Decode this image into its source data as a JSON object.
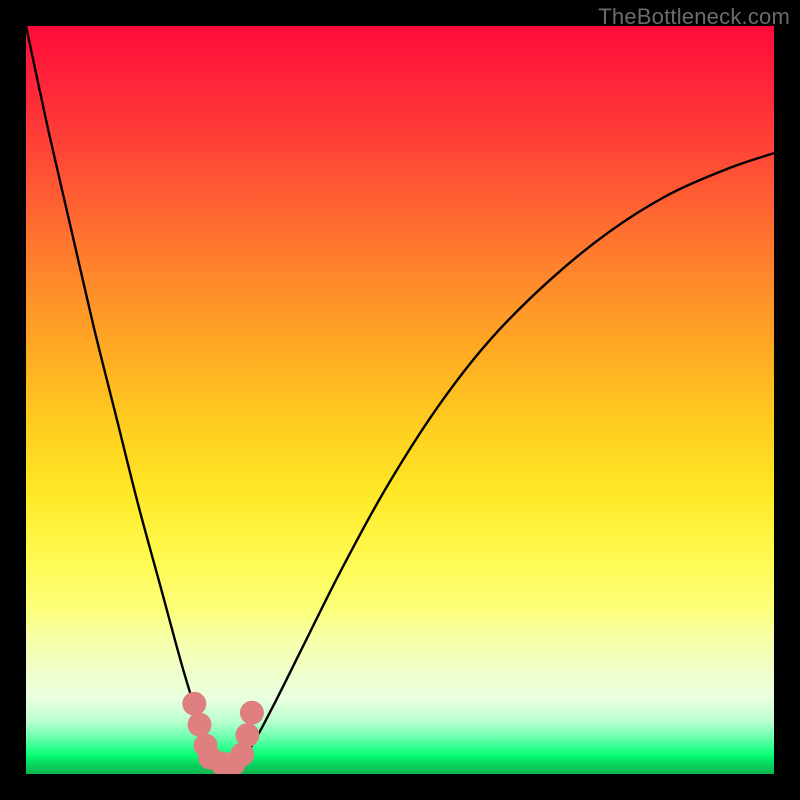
{
  "watermark": {
    "text": "TheBottleneck.com"
  },
  "chart_data": {
    "type": "line",
    "title": "",
    "xlabel": "",
    "ylabel": "",
    "xlim": [
      0,
      100
    ],
    "ylim": [
      0,
      100
    ],
    "grid": false,
    "legend": false,
    "series": [
      {
        "name": "bottleneck-curve",
        "x": [
          0,
          3,
          6,
          9,
          12,
          15,
          18,
          21,
          23.5,
          25,
          26.5,
          28,
          30,
          33,
          37,
          42,
          48,
          55,
          62,
          70,
          78,
          86,
          94,
          100
        ],
        "values": [
          100,
          86,
          73,
          60,
          48,
          36,
          25,
          14,
          6,
          2,
          1,
          1.5,
          3.5,
          9,
          17,
          27,
          38,
          49,
          58,
          66,
          72.5,
          77.5,
          81,
          83
        ]
      }
    ],
    "markers": [
      {
        "name": "dot",
        "x": 22.5,
        "y": 9.4,
        "r": 1.6,
        "color": "#df7f7f"
      },
      {
        "name": "dot",
        "x": 23.2,
        "y": 6.6,
        "r": 1.6,
        "color": "#df7f7f"
      },
      {
        "name": "dot",
        "x": 24.0,
        "y": 3.8,
        "r": 1.6,
        "color": "#df7f7f"
      },
      {
        "name": "dot",
        "x": 24.6,
        "y": 2.2,
        "r": 1.6,
        "color": "#df7f7f"
      },
      {
        "name": "dot",
        "x": 26.2,
        "y": 1.4,
        "r": 1.6,
        "color": "#df7f7f"
      },
      {
        "name": "dot",
        "x": 27.8,
        "y": 1.4,
        "r": 1.6,
        "color": "#df7f7f"
      },
      {
        "name": "dot",
        "x": 28.9,
        "y": 2.6,
        "r": 1.6,
        "color": "#df7f7f"
      },
      {
        "name": "dot",
        "x": 29.6,
        "y": 5.2,
        "r": 1.6,
        "color": "#df7f7f"
      },
      {
        "name": "dot",
        "x": 30.2,
        "y": 8.2,
        "r": 1.6,
        "color": "#df7f7f"
      }
    ],
    "colors": {
      "curve": "#000000",
      "marker": "#df7f7f"
    }
  }
}
